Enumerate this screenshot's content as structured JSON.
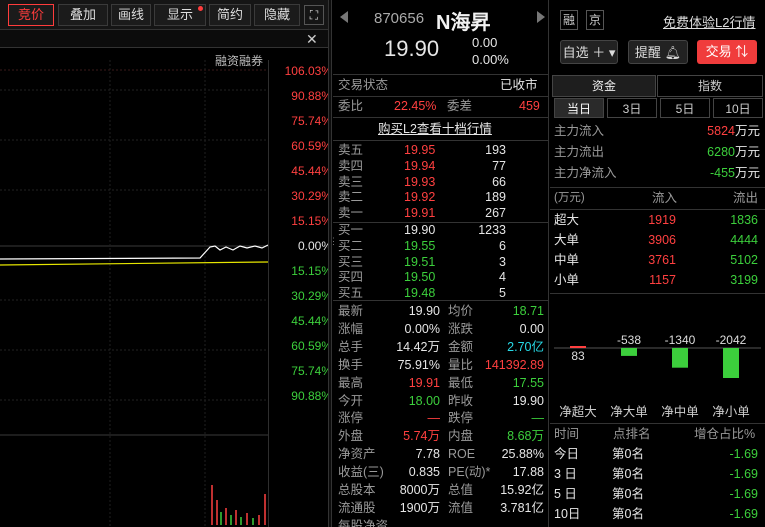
{
  "toolbar": {
    "items": [
      {
        "label": "竞价",
        "active": true
      },
      {
        "label": "叠加"
      },
      {
        "label": "画线"
      },
      {
        "label": "显示",
        "dot": true
      },
      {
        "label": "简约"
      },
      {
        "label": "隐藏"
      }
    ]
  },
  "chart": {
    "title": "融资融券",
    "pct_red": [
      "106.03%",
      "90.88%",
      "75.74%",
      "60.59%",
      "45.44%",
      "30.29%",
      "15.15%"
    ],
    "pct_zero": "0.00%",
    "pct_green": [
      "15.15%",
      "30.29%",
      "45.44%",
      "60.59%",
      "75.74%",
      "90.88%"
    ]
  },
  "stock": {
    "code": "870656",
    "name": "N海昇",
    "price": "19.90",
    "change": "0.00",
    "change_pct": "0.00%",
    "tag_margin": "融",
    "tag_exchange": "京",
    "l2_link": "免费体验L2行情"
  },
  "actions": {
    "watch": "自选",
    "alert": "提醒",
    "trade": "交易"
  },
  "status": {
    "label": "交易状态",
    "value": "已收市",
    "wei_bi_label": "委比",
    "wei_bi": "22.45%",
    "wei_cha_label": "委差",
    "wei_cha": "459",
    "buy_l2": "购买L2查看十档行情"
  },
  "asks": [
    {
      "label": "卖五",
      "price": "19.95",
      "vol": "193"
    },
    {
      "label": "卖四",
      "price": "19.94",
      "vol": "77"
    },
    {
      "label": "卖三",
      "price": "19.93",
      "vol": "66"
    },
    {
      "label": "卖二",
      "price": "19.92",
      "vol": "189"
    },
    {
      "label": "卖一",
      "price": "19.91",
      "vol": "267"
    }
  ],
  "bids": [
    {
      "label": "买一",
      "price": "19.90",
      "vol": "1233"
    },
    {
      "label": "买二",
      "price": "19.55",
      "vol": "6"
    },
    {
      "label": "买三",
      "price": "19.51",
      "vol": "3"
    },
    {
      "label": "买四",
      "price": "19.50",
      "vol": "4"
    },
    {
      "label": "买五",
      "price": "19.48",
      "vol": "5"
    }
  ],
  "stats": [
    [
      "最新",
      "19.90",
      "均价",
      "18.71"
    ],
    [
      "涨幅",
      "0.00%",
      "涨跌",
      "0.00"
    ],
    [
      "总手",
      "14.42万",
      "金额",
      "2.70亿"
    ],
    [
      "换手",
      "75.91%",
      "量比",
      "141392.89"
    ],
    [
      "最高",
      "19.91",
      "最低",
      "17.55"
    ],
    [
      "今开",
      "18.00",
      "昨收",
      "19.90"
    ],
    [
      "涨停",
      "—",
      "跌停",
      "—"
    ],
    [
      "外盘",
      "5.74万",
      "内盘",
      "8.68万"
    ],
    [
      "净资产",
      "7.78",
      "ROE",
      "25.88%"
    ],
    [
      "收益(三)",
      "0.835",
      "PE(动)*",
      "17.88"
    ],
    [
      "总股本",
      "8000万",
      "总值",
      "15.92亿"
    ],
    [
      "流通股",
      "1900万",
      "流值",
      "3.781亿"
    ],
    [
      "每股净资",
      "",
      "",
      " "
    ]
  ],
  "fund": {
    "tab_fund": "资金",
    "tab_index": "指数",
    "periods": [
      "当日",
      "3日",
      "5日",
      "10日"
    ],
    "main_in_label": "主力流入",
    "main_in": "5824",
    "main_out_label": "主力流出",
    "main_out": "6280",
    "main_net_label": "主力净流入",
    "main_net": "-455",
    "unit": "万元",
    "table_unit": "(万元)",
    "col_in": "流入",
    "col_out": "流出",
    "rows": [
      {
        "label": "超大",
        "in": "1919",
        "out": "1836"
      },
      {
        "label": "大单",
        "in": "3906",
        "out": "4444"
      },
      {
        "label": "中单",
        "in": "3761",
        "out": "5102"
      },
      {
        "label": "小单",
        "in": "1157",
        "out": "3199"
      }
    ],
    "net_values": [
      83,
      -538,
      -1340,
      -2042
    ],
    "net_labels": [
      "83",
      "-538",
      "-1340",
      "-2042"
    ],
    "net_names": [
      "净超大",
      "净大单",
      "净中单",
      "净小单"
    ]
  },
  "rank": {
    "col_time": "时间",
    "col_rank": "点排名",
    "col_chg": "增仓占比%",
    "rows": [
      {
        "t": "今日",
        "r": "第0名",
        "v": "-1.69"
      },
      {
        "t": "3 日",
        "r": "第0名",
        "v": "-1.69"
      },
      {
        "t": "5 日",
        "r": "第0名",
        "v": "-1.69"
      },
      {
        "t": "10日",
        "r": "第0名",
        "v": "-1.69"
      }
    ]
  },
  "colors": {
    "up": "#ff4040",
    "down": "#3ccf3c",
    "bg": "#000000",
    "accent": "#ff3c3c"
  }
}
